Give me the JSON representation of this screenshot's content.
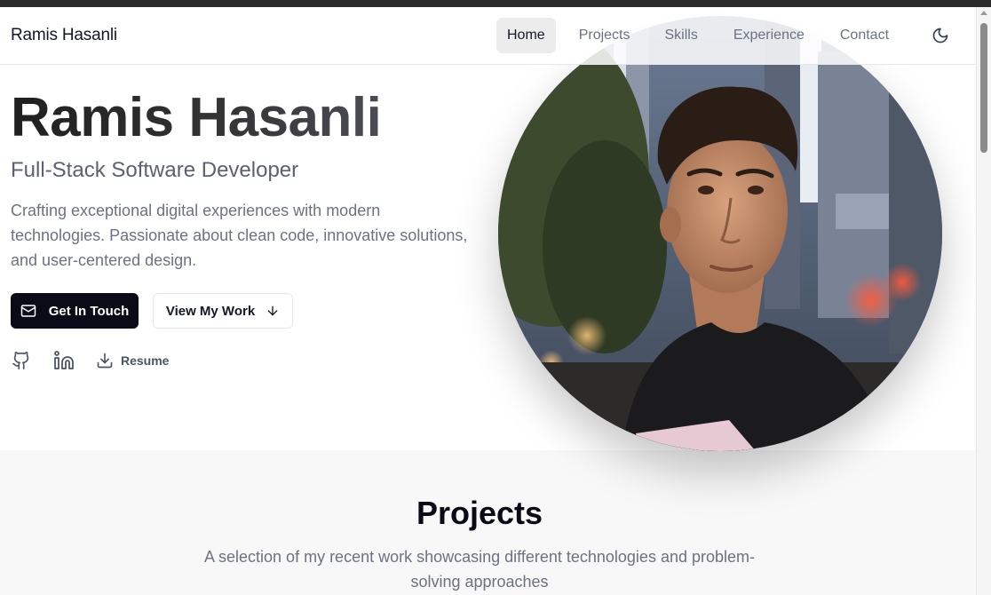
{
  "header": {
    "brand": "Ramis Hasanli",
    "nav": [
      {
        "label": "Home",
        "active": true
      },
      {
        "label": "Projects",
        "active": false
      },
      {
        "label": "Skills",
        "active": false
      },
      {
        "label": "Experience",
        "active": false
      },
      {
        "label": "Contact",
        "active": false
      }
    ],
    "theme_icon": "moon-icon"
  },
  "hero": {
    "name": "Ramis Hasanli",
    "role": "Full-Stack Software Developer",
    "description": "Crafting exceptional digital experiences with modern technologies. Passionate about clean code, innovative solutions, and user-centered design.",
    "primary_button": {
      "label": "Get In Touch",
      "icon": "mail-icon"
    },
    "secondary_button": {
      "label": "View My Work",
      "icon": "arrow-down-icon"
    },
    "social": {
      "github_icon": "github-icon",
      "linkedin_icon": "linkedin-icon",
      "resume_label": "Resume",
      "resume_icon": "download-icon"
    },
    "portrait_icon": "profile-photo"
  },
  "projects": {
    "title": "Projects",
    "subtitle": "A selection of my recent work showcasing different technologies and problem-solving approaches"
  },
  "colors": {
    "primary_button_bg": "#0b0b18",
    "section_bg": "#f8f8f8",
    "muted_text": "#6b7280",
    "active_nav_bg": "#ececec"
  }
}
